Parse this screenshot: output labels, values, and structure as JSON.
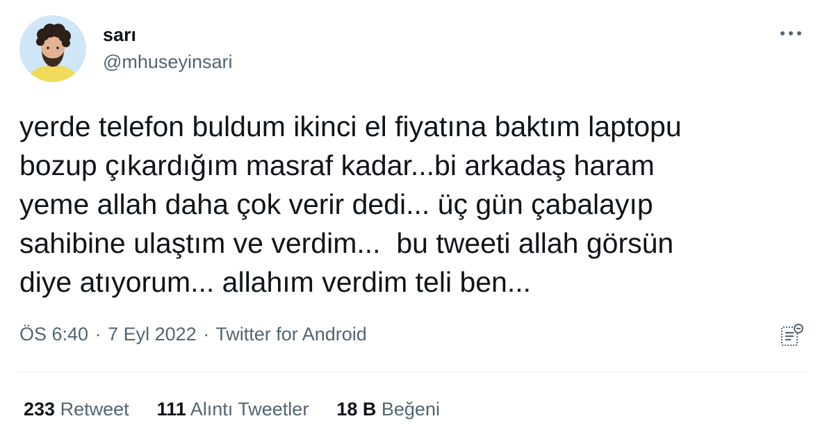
{
  "user": {
    "display_name": "sarı",
    "handle": "@mhuseyinsari",
    "avatar_icon": "profile-photo-avatar"
  },
  "tweet": {
    "text_lines": [
      "yerde telefon buldum ikinci el fiyatına baktım laptopu",
      "bozup çıkardığım masraf kadar...bi arkadaş haram",
      "yeme allah daha çok verir dedi... üç gün çabalayıp",
      "sahibine ulaştım ve verdim...  bu tweeti allah görsün",
      "diye atıyorum... allahım verdim teli ben..."
    ]
  },
  "meta": {
    "time": "ÖS 6:40",
    "separator": "·",
    "date": "7 Eyl 2022",
    "source": "Twitter for Android"
  },
  "stats": {
    "retweets_count": "233",
    "retweets_label": "Retweet",
    "quotes_count": "111",
    "quotes_label": "Alıntı Tweetler",
    "likes_count": "18 B",
    "likes_label": "Beğeni"
  },
  "icons": {
    "more": "more-horizontal-icon",
    "analytics": "tweet-analytics-icon"
  },
  "colors": {
    "text_primary": "#0f1419",
    "text_secondary": "#536471",
    "divider": "#eff3f4"
  }
}
